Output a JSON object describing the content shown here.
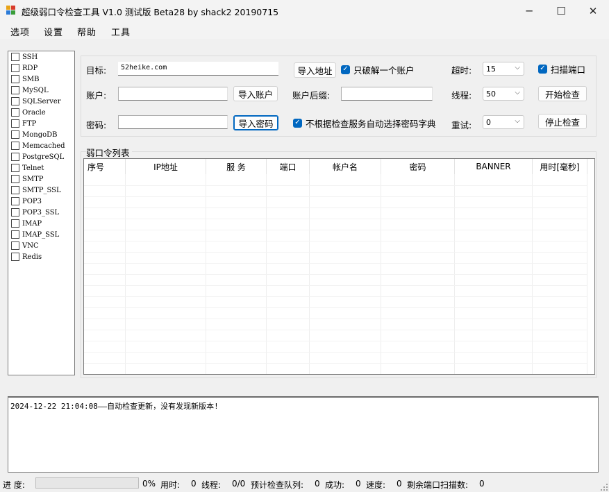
{
  "window": {
    "title": "超级弱口令检查工具 V1.0 测试版 Beta28 by shack2 20190715",
    "icon": "app-icon",
    "controls": {
      "minimize": "─",
      "maximize": "☐",
      "close": "✕"
    }
  },
  "menu": [
    "选项",
    "设置",
    "帮助",
    "工具"
  ],
  "services": [
    "SSH",
    "RDP",
    "SMB",
    "MySQL",
    "SQLServer",
    "Oracle",
    "FTP",
    "MongoDB",
    "Memcached",
    "PostgreSQL",
    "Telnet",
    "SMTP",
    "SMTP_SSL",
    "POP3",
    "POP3_SSL",
    "IMAP",
    "IMAP_SSL",
    "VNC",
    "Redis"
  ],
  "form": {
    "target_label": "目标:",
    "target_value": "52heike.com",
    "import_target_btn": "导入地址",
    "crack_one_label": "只破解一个账户",
    "timeout_label": "超时:",
    "timeout_value": "15",
    "scan_port_label": "扫描端口",
    "account_label": "账户:",
    "account_value": "",
    "import_account_btn": "导入账户",
    "suffix_label": "账户后缀:",
    "suffix_value": "",
    "threads_label": "线程:",
    "threads_value": "50",
    "start_btn": "开始检查",
    "password_label": "密码:",
    "password_value": "",
    "import_password_btn": "导入密码",
    "auto_dict_label": "不根据检查服务自动选择密码字典",
    "retry_label": "重试:",
    "retry_value": "0",
    "stop_btn": "停止检查"
  },
  "results": {
    "title": "弱口令列表",
    "columns": [
      "序号",
      "IP地址",
      "服 务",
      "端口",
      "帐户名",
      "密码",
      "BANNER",
      "用时[毫秒]"
    ],
    "rows": []
  },
  "log": {
    "lines": [
      "2024-12-22 21:04:08——自动检查更新，没有发现新版本!"
    ]
  },
  "status": {
    "progress_label": "进 度:",
    "progress_value": 0,
    "progress_text": "0%",
    "elapsed_label": "用时:",
    "elapsed_value": "0",
    "threads_label": "线程:",
    "threads_value": "0/0",
    "queue_label": "预计检查队列:",
    "queue_value": "0",
    "success_label": "成功:",
    "success_value": "0",
    "speed_label": "速度:",
    "speed_value": "0",
    "ports_left_label": "剩余端口扫描数:",
    "ports_left_value": "0"
  }
}
